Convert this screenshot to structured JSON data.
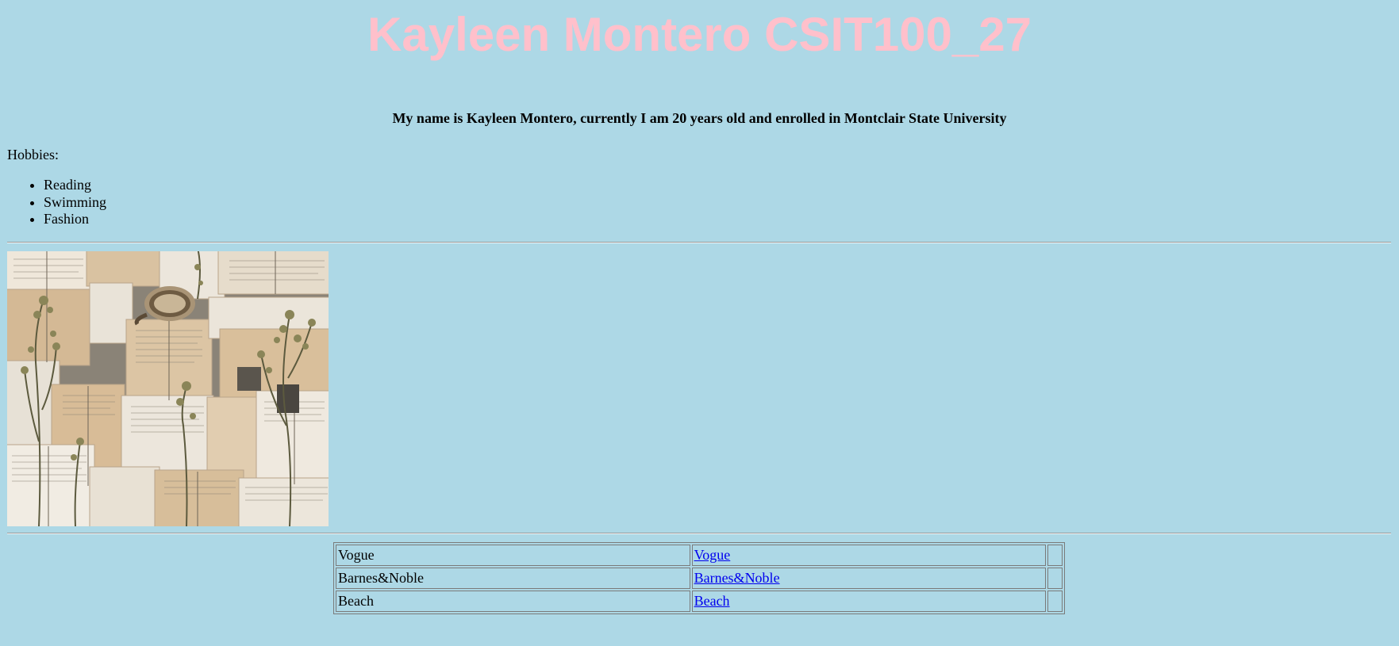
{
  "header": {
    "title": "Kayleen Montero CSIT100_27"
  },
  "intro": {
    "text": "My name is Kayleen Montero, currently I am 20 years old and enrolled in Montclair State University"
  },
  "hobbies": {
    "label": "Hobbies:",
    "items": [
      "Reading",
      "Swimming",
      "Fashion"
    ]
  },
  "photo": {
    "subject": "open books with dried flowers and a cup"
  },
  "links_table": {
    "rows": [
      {
        "name": "Vogue",
        "link_text": "Vogue",
        "extra": ""
      },
      {
        "name": "Barnes&Noble",
        "link_text": "Barnes&Noble",
        "extra": ""
      },
      {
        "name": "Beach",
        "link_text": "Beach",
        "extra": ""
      }
    ]
  },
  "colors": {
    "background": "#add8e6",
    "title": "#ffc0cb",
    "link": "#0000ee"
  }
}
